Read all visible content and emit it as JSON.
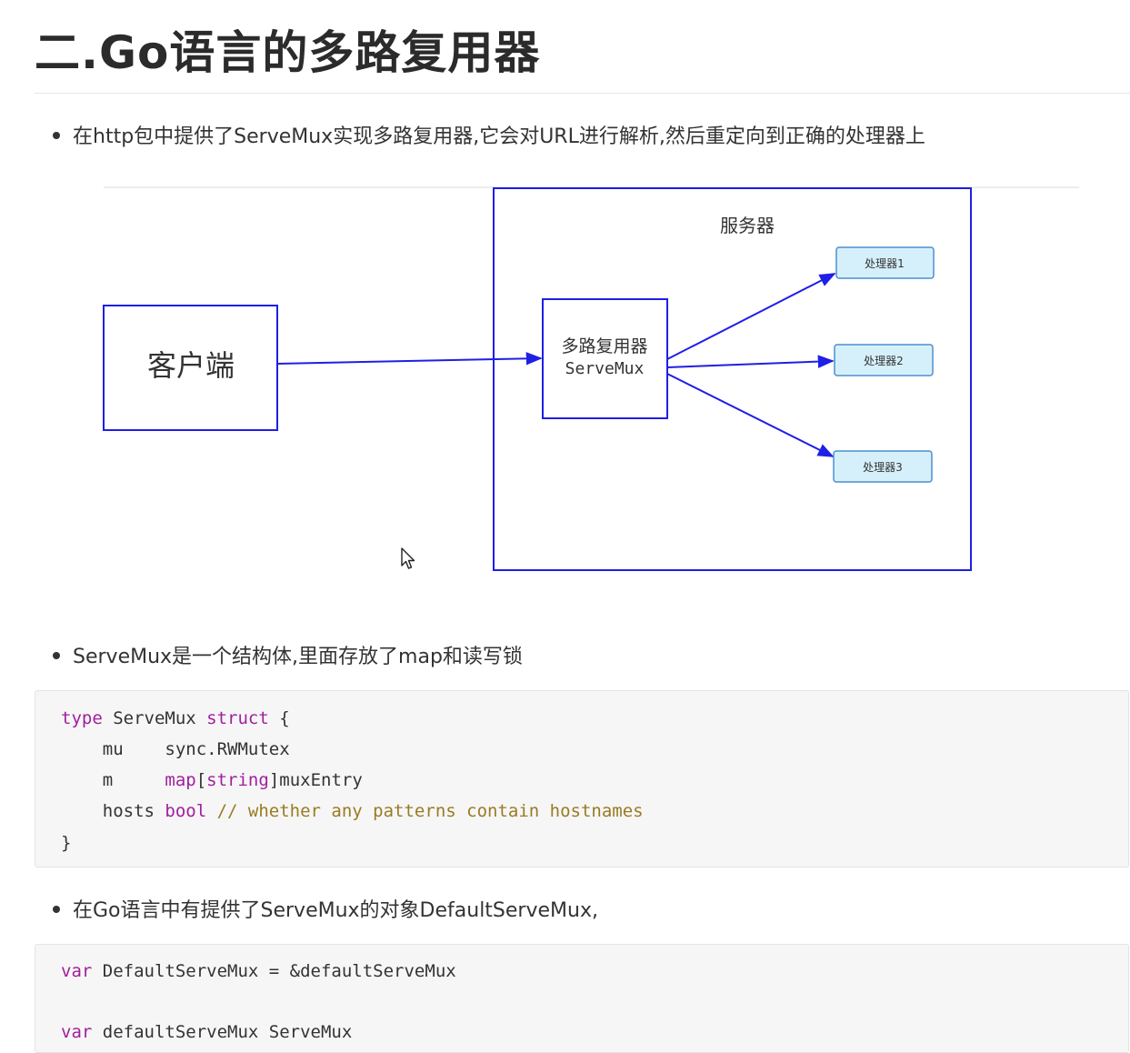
{
  "heading": "二.Go语言的多路复用器",
  "bullets": [
    "在http包中提供了ServeMux实现多路复用器,它会对URL进行解析,然后重定向到正确的处理器上",
    "ServeMux是一个结构体,里面存放了map和读写锁",
    "在Go语言中有提供了ServeMux的对象DefaultServeMux,"
  ],
  "diagram": {
    "client_label": "客户端",
    "server_label": "服务器",
    "mux_label_cn": "多路复用器",
    "mux_label_en": "ServeMux",
    "handlers": [
      "处理器1",
      "处理器2",
      "处理器3"
    ],
    "line_color": "#1f1fe6",
    "handler_fill": "#d6f0fb"
  },
  "code1": {
    "l1_kw": "type",
    "l1_name": " ServeMux ",
    "l1_kw2": "struct",
    "l1_brace": " {",
    "l2_field": "    mu    ",
    "l2_type": "sync.RWMutex",
    "l3_field": "    m     ",
    "l3_map": "map",
    "l3_open": "[",
    "l3_string": "string",
    "l3_close": "]muxEntry",
    "l4_field": "    hosts ",
    "l4_type": "bool",
    "l4_comment": " // whether any patterns contain hostnames",
    "l5": "}"
  },
  "code2": {
    "l1_kw": "var",
    "l1_rest": " DefaultServeMux = &defaultServeMux",
    "l3_kw": "var",
    "l3_rest": " defaultServeMux ServeMux"
  },
  "colors": {
    "keyword": "#a11f9e",
    "comment": "#9a7b23",
    "code_bg": "#f6f6f6"
  }
}
